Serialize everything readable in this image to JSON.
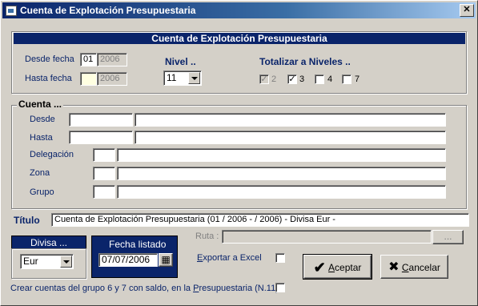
{
  "window": {
    "title": "Cuenta de Explotación Presupuestaria",
    "close_glyph": "✕"
  },
  "banner": {
    "title": "Cuenta de Explotación Presupuestaria"
  },
  "period": {
    "desde_label": "Desde fecha",
    "desde_month": "01",
    "desde_year": "2006",
    "hasta_label": "Hasta fecha",
    "hasta_month": "",
    "hasta_year": "2006"
  },
  "nivel": {
    "label": "Nivel ..",
    "value": "11"
  },
  "totalizar": {
    "label": "Totalizar a Niveles ..",
    "levels": [
      {
        "label": "2",
        "checked": true,
        "disabled": true
      },
      {
        "label": "3",
        "checked": true,
        "disabled": false
      },
      {
        "label": "4",
        "checked": false,
        "disabled": false
      },
      {
        "label": "7",
        "checked": false,
        "disabled": false
      }
    ]
  },
  "cuenta": {
    "group_label": "Cuenta ...",
    "desde_label": "Desde",
    "hasta_label": "Hasta",
    "delegacion_label": "Delegación",
    "zona_label": "Zona",
    "grupo_label": "Grupo"
  },
  "titulo": {
    "label": "Título",
    "value": "Cuenta de Explotación Presupuestaria (01 / 2006 -  / 2006)   - Divisa Eur -"
  },
  "divisa": {
    "label": "Divisa ...",
    "value": "Eur"
  },
  "fecha_listado": {
    "label": "Fecha listado",
    "value": "07/07/2006",
    "calendar_glyph": "▦"
  },
  "ruta": {
    "label": "Ruta :",
    "value": "",
    "browse_label": "..."
  },
  "exportar": {
    "label_prefix": "",
    "label_accel": "E",
    "label_rest": "xportar a Excel",
    "checked": false
  },
  "aceptar": {
    "label_accel": "A",
    "label_rest": "ceptar",
    "icon": "✔"
  },
  "cancelar": {
    "label_accel": "C",
    "label_rest": "ancelar",
    "icon": "✖"
  },
  "crear": {
    "label_prefix": "Crear cuentas del grupo 6 y 7 con saldo, en la ",
    "label_accel": "P",
    "label_rest": "resupuestaria (N.11)",
    "checked": false
  }
}
